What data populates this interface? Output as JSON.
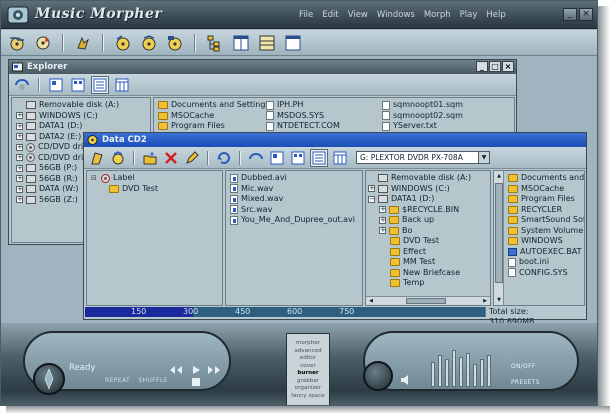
{
  "app": {
    "title": "Music Morpher",
    "menu": [
      "File",
      "Edit",
      "View",
      "Windows",
      "Morph",
      "Play",
      "Help"
    ]
  },
  "toolbar": {
    "icons": [
      "open-disc-icon",
      "burn-disc-icon",
      "rip-icon",
      "audio-cd-icon",
      "mp3-cd-icon",
      "video-cd-icon",
      "tree-view-icon",
      "split-view-icon",
      "layout-icon",
      "window-icon"
    ]
  },
  "explorer": {
    "title": "Explorer",
    "tree": [
      {
        "label": "Removable disk (A:)",
        "icon": "drive"
      },
      {
        "label": "WINDOWS (C:)",
        "icon": "drive"
      },
      {
        "label": "DATA1 (D:)",
        "icon": "drive"
      },
      {
        "label": "DATA2 (E:)",
        "icon": "drive"
      },
      {
        "label": "CD/DVD drive",
        "icon": "cd"
      },
      {
        "label": "CD/DVD drive",
        "icon": "cd"
      },
      {
        "label": "56GB (P:)",
        "icon": "drive"
      },
      {
        "label": "56GB (R:)",
        "icon": "drive"
      },
      {
        "label": "DATA (W:)",
        "icon": "drive"
      },
      {
        "label": "56GB (Z:)",
        "icon": "drive"
      }
    ],
    "files_col1": [
      "Documents and Settings",
      "MSOCache",
      "Program Files"
    ],
    "files_col2": [
      "IPH.PH",
      "MSDOS.SYS",
      "NTDETECT.COM"
    ],
    "files_col3": [
      "sqmnoopt01.sqm",
      "sqmnoopt02.sqm",
      "YServer.txt"
    ]
  },
  "datacd": {
    "title": "Data CD2",
    "drive_select": "G: PLEXTOR DVDR   PX-708A",
    "tree_label": "Label",
    "tree_item": "DVD Test",
    "files": [
      "Dubbed.avi",
      "Mic.wav",
      "Mixed.wav",
      "Src.wav",
      "You_Me_And_Dupree_out.avi"
    ],
    "dir_tree": [
      {
        "label": "Removable disk (A:)",
        "icon": "drive",
        "indent": 1
      },
      {
        "label": "WINDOWS (C:)",
        "icon": "drive",
        "indent": 1
      },
      {
        "label": "DATA1 (D:)",
        "icon": "drive",
        "indent": 1
      },
      {
        "label": "$RECYCLE.BIN",
        "icon": "folder",
        "indent": 2
      },
      {
        "label": "Back up",
        "icon": "folder",
        "indent": 2
      },
      {
        "label": "Bo",
        "icon": "folder",
        "indent": 2
      },
      {
        "label": "DVD Test",
        "icon": "folder",
        "indent": 3
      },
      {
        "label": "Effect",
        "icon": "folder",
        "indent": 3
      },
      {
        "label": "MM Test",
        "icon": "folder",
        "indent": 3
      },
      {
        "label": "New Briefcase",
        "icon": "folder",
        "indent": 3
      },
      {
        "label": "Temp",
        "icon": "folder",
        "indent": 3
      }
    ],
    "right_files": [
      {
        "label": "Documents and Settin",
        "icon": "folder"
      },
      {
        "label": "MSOCache",
        "icon": "folder"
      },
      {
        "label": "Program Files",
        "icon": "folder"
      },
      {
        "label": "RECYCLER",
        "icon": "folder"
      },
      {
        "label": "SmartSound Software",
        "icon": "folder"
      },
      {
        "label": "System Volume Inforr",
        "icon": "folder"
      },
      {
        "label": "WINDOWS",
        "icon": "folder"
      },
      {
        "label": "AUTOEXEC.BAT",
        "icon": "exe"
      },
      {
        "label": "boot.ini",
        "icon": "file"
      },
      {
        "label": "CONFIG.SYS",
        "icon": "file"
      }
    ],
    "capacity_ticks": [
      "150",
      "300",
      "450",
      "600",
      "750"
    ],
    "capacity_used_fraction": 0.27,
    "total_size": "Total size: 310.690MB"
  },
  "player": {
    "status": "Ready",
    "repeat_label": "REPEAT",
    "shuffle_label": "SHUFFLE",
    "modes": [
      "morpher",
      "advanced",
      "editor",
      "cover",
      "burner",
      "grabber",
      "organizer",
      "fancy space"
    ],
    "active_modes": [
      "burner"
    ],
    "onoff_label": "ON/OFF",
    "presets_label": "PRESETS",
    "eq_levels": [
      0.55,
      0.7,
      0.6,
      0.8,
      0.65,
      0.75,
      0.5,
      0.6,
      0.7
    ]
  },
  "colors": {
    "chrome": "#9fb4be",
    "active_title": "#1c4fb5",
    "capacity_fill": "#1a2a9c"
  }
}
